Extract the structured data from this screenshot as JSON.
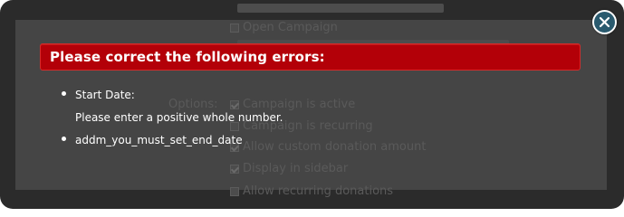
{
  "background_page": {
    "open_campaign_label": "Open Campaign",
    "options_label": "Options:",
    "options": [
      {
        "label": "Campaign is active",
        "checked": true
      },
      {
        "label": "Campaign is recurring",
        "checked": false
      },
      {
        "label": "Allow custom donation amount",
        "checked": true
      },
      {
        "label": "Display in sidebar",
        "checked": true
      },
      {
        "label": "Allow recurring donations",
        "checked": false
      }
    ]
  },
  "dialog": {
    "title": "Please correct the following errors:",
    "errors": [
      {
        "field": "Start Date:",
        "message": "Please enter a positive whole number."
      },
      {
        "field": "addm_you_must_set_end_date",
        "message": ""
      }
    ],
    "close_icon": "close-icon"
  },
  "colors": {
    "error_bar": "#b30008",
    "overlay": "#454545",
    "frame": "#2b2b2b",
    "close_button": "#2a5a6e"
  }
}
